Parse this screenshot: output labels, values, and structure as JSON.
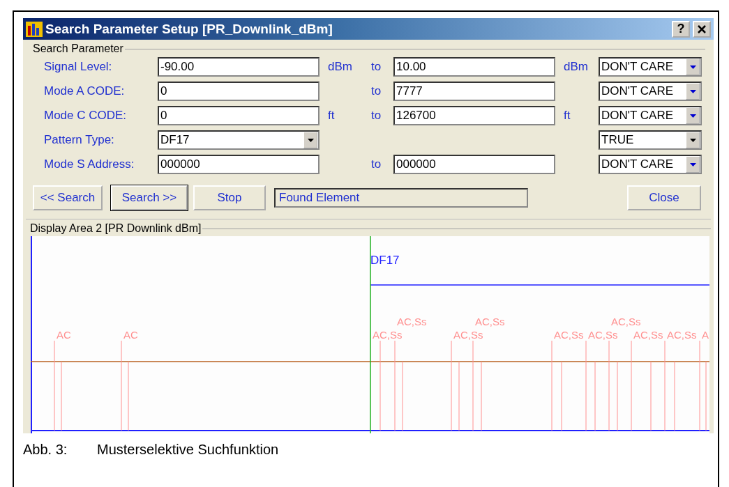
{
  "window": {
    "title": "Search Parameter Setup [PR_Downlink_dBm]",
    "help": "?"
  },
  "search_parameter": {
    "legend": "Search Parameter",
    "rows": [
      {
        "kind": "range",
        "label": "Signal Level:",
        "from": "-90.00",
        "from_unit": "dBm",
        "to_label": "to",
        "to": "10.00",
        "to_unit": "dBm",
        "condition": "DON'T CARE"
      },
      {
        "kind": "range",
        "label": "Mode A CODE:",
        "from": "0",
        "to_label": "to",
        "to": "7777",
        "condition": "DON'T CARE"
      },
      {
        "kind": "range",
        "label": "Mode C CODE:",
        "from": "0",
        "from_unit": "ft",
        "to_label": "to",
        "to": "126700",
        "to_unit": "ft",
        "condition": "DON'T CARE"
      },
      {
        "kind": "select",
        "label": "Pattern Type:",
        "from": "DF17",
        "condition": "TRUE"
      },
      {
        "kind": "range",
        "label": "Mode S Address:",
        "from": "000000",
        "to_label": "to",
        "to": "000000",
        "condition": "DON'T CARE"
      }
    ]
  },
  "buttons": [
    {
      "label": "<< Search",
      "default": false
    },
    {
      "label": "Search >>",
      "default": true
    },
    {
      "label": "Stop",
      "default": false
    }
  ],
  "status": "Found Element",
  "close": "Close",
  "display": {
    "legend": "Display Area 2 [PR  Downlink  dBm]",
    "marker": "DF17",
    "pulses": [
      "AC",
      "AC",
      "AC,Ss",
      "AC,Ss",
      "AC,Ss",
      "AC,Ss",
      "AC,Ss",
      "AC,Ss",
      "AC,Ss",
      "AC,Ss",
      "AC,Ss",
      "A"
    ]
  },
  "caption": {
    "number": "Abb. 3:",
    "text": "Musterselektive Suchfunktion"
  }
}
